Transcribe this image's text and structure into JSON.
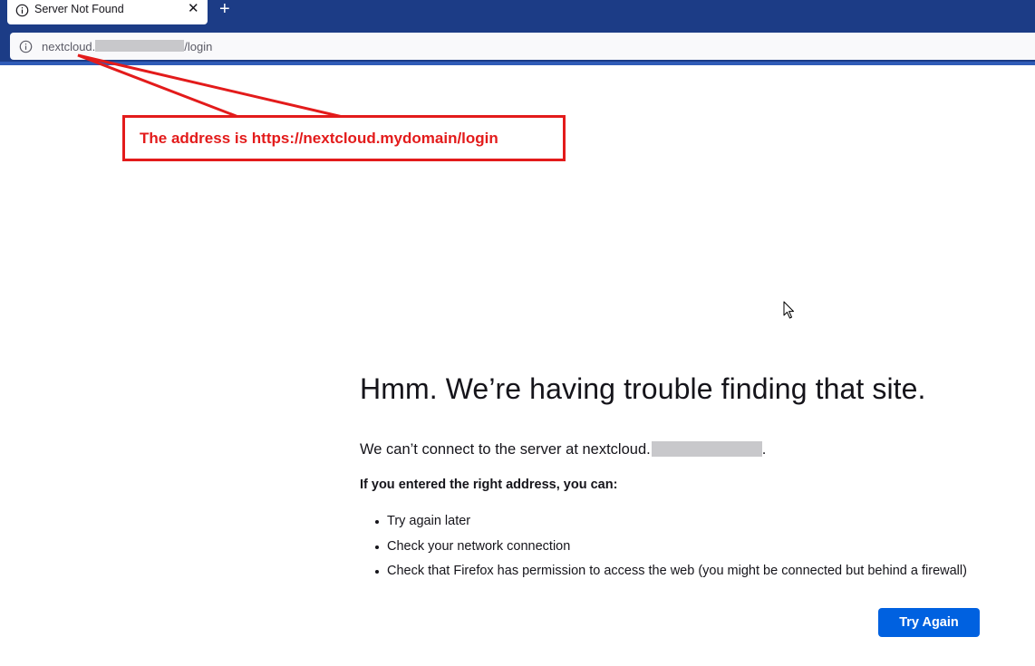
{
  "tab": {
    "title": "Server Not Found",
    "icon": "info-icon",
    "close_label": "✕",
    "new_tab_label": "+"
  },
  "urlbar": {
    "icon": "info-icon",
    "url_prefix": "nextcloud.",
    "url_suffix": "/login"
  },
  "annotation": {
    "text": "The address is https://nextcloud.mydomain/login",
    "color": "#e31b1b"
  },
  "error": {
    "title": "Hmm. We’re having trouble finding that site.",
    "description_prefix": "We can’t connect to the server at nextcloud.",
    "description_suffix": ".",
    "subheading": "If you entered the right address, you can:",
    "suggestions": [
      "Try again later",
      "Check your network connection",
      "Check that Firefox has permission to access the web (you might be connected but behind a firewall)"
    ],
    "try_again_label": "Try Again"
  },
  "colors": {
    "chrome": "#1c3c86",
    "button": "#0061e0",
    "redaction": "#c8c8cb"
  }
}
